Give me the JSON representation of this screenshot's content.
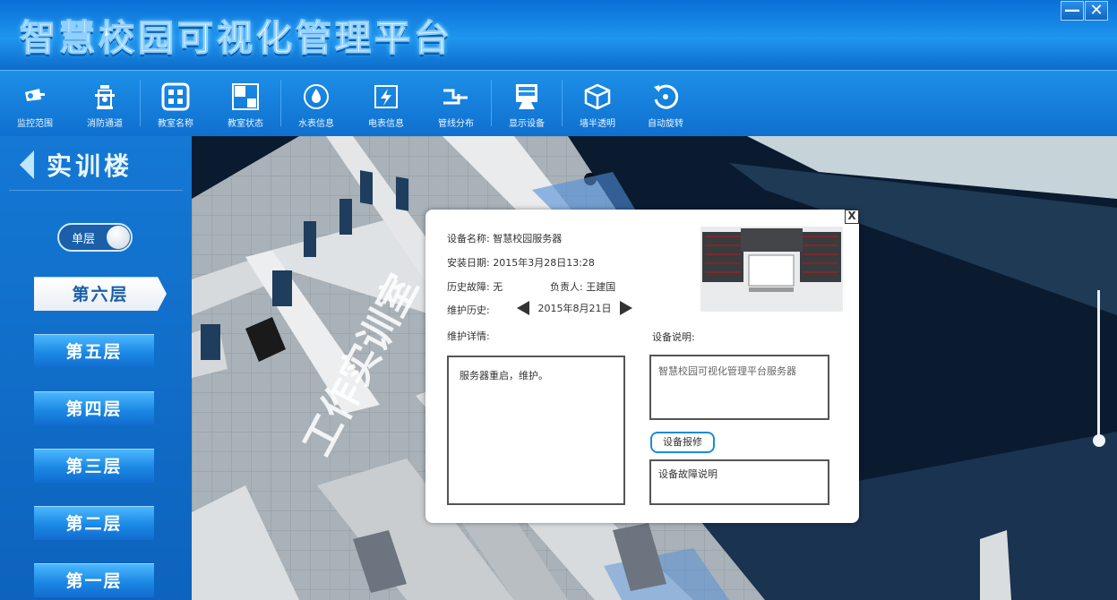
{
  "app": {
    "title": "智慧校园可视化管理平台",
    "minimize_label": "—",
    "close_label": "✕"
  },
  "toolbar": {
    "items": [
      {
        "label": "监控范围",
        "icon": "camera-icon"
      },
      {
        "label": "消防通道",
        "icon": "fire-hydrant-icon"
      },
      {
        "label": "教室名称",
        "icon": "grid-icon"
      },
      {
        "label": "教室状态",
        "icon": "status-grid-icon"
      },
      {
        "label": "水表信息",
        "icon": "water-drop-icon"
      },
      {
        "label": "电表信息",
        "icon": "electric-meter-icon"
      },
      {
        "label": "管线分布",
        "icon": "pipeline-icon"
      },
      {
        "label": "显示设备",
        "icon": "monitor-icon"
      },
      {
        "label": "墙半透明",
        "icon": "cube-icon"
      },
      {
        "label": "自动旋转",
        "icon": "rotate-icon"
      }
    ]
  },
  "sidebar": {
    "building": "实训楼",
    "toggle_label": "单层",
    "floors": [
      "第六层",
      "第五层",
      "第四层",
      "第三层",
      "第二层",
      "第一层"
    ],
    "active_floor": "第六层"
  },
  "scene": {
    "room_label": "工作实训室"
  },
  "dialog": {
    "device_name_label": "设备名称:",
    "device_name": "智慧校园服务器",
    "install_date_label": "安装日期:",
    "install_date": "2015年3月28日13:28",
    "fault_history_label": "历史故障:",
    "fault_history": "无",
    "owner_label": "负责人:",
    "owner": "王建国",
    "maint_history_label": "维护历史:",
    "maint_date": "2015年8月21日",
    "maint_detail_label": "维护详情:",
    "maint_detail": "服务器重启，维护。",
    "device_desc_label": "设备说明:",
    "device_desc": "智慧校园可视化管理平台服务器",
    "repair_button": "设备报修",
    "fault_desc_placeholder": "设备故障说明",
    "close_label": "X"
  }
}
